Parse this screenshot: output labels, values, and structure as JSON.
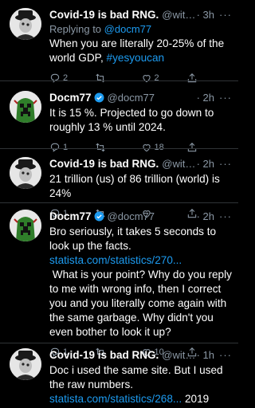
{
  "tweets": [
    {
      "name": "Covid-19 is bad RNG.",
      "handle": "@withco...",
      "time": "· 3h",
      "replying_prefix": "Replying to ",
      "replying_to": "@docm77",
      "text_a": "When you are literally 20-25% of the world GDP, ",
      "text_link": "#yesyoucan",
      "text_b": "",
      "reply_count": "2",
      "retweet_count": "",
      "like_count": "2"
    },
    {
      "name": "Docm77",
      "handle": "@docm77",
      "time": "· 2h",
      "text_a": "It is 15 %. Projected to go down to roughly 13 % until 2024.",
      "reply_count": "1",
      "retweet_count": "",
      "like_count": "18"
    },
    {
      "name": "Covid-19 is bad RNG.",
      "handle": "@withco...",
      "time": "· 2h",
      "text_a": "21 trillion (us) of 86 trillion (world) is 24%",
      "reply_count": "1",
      "retweet_count": "",
      "like_count": ""
    },
    {
      "name": "Docm77",
      "handle": "@docm77",
      "time": "· 2h",
      "text_a": "Bro seriously, it takes 5 seconds to look up the facts.\n",
      "text_link": "statista.com/statistics/270...",
      "text_b": "\n What is your point? Why do you reply to me with wrong info, then I correct you and you literally come again with the same garbage. Why didn't you even bother to look it up?",
      "reply_count": "1",
      "retweet_count": "",
      "like_count": "10"
    },
    {
      "name": "Covid-19 is bad RNG.",
      "handle": "@withcom...",
      "time": "· 1h",
      "text_a": "Doc i used the same site. But I used the raw numbers. ",
      "text_link": "statista.com/statistics/268...",
      "text_b": " 2019 numbers.",
      "reply_count": "",
      "retweet_count": "",
      "like_count": ""
    }
  ],
  "more_label": "···",
  "colors": {
    "accent": "#1d9bf0",
    "muted": "#8b98a5",
    "background": "#000000",
    "divider": "#2f3336"
  }
}
